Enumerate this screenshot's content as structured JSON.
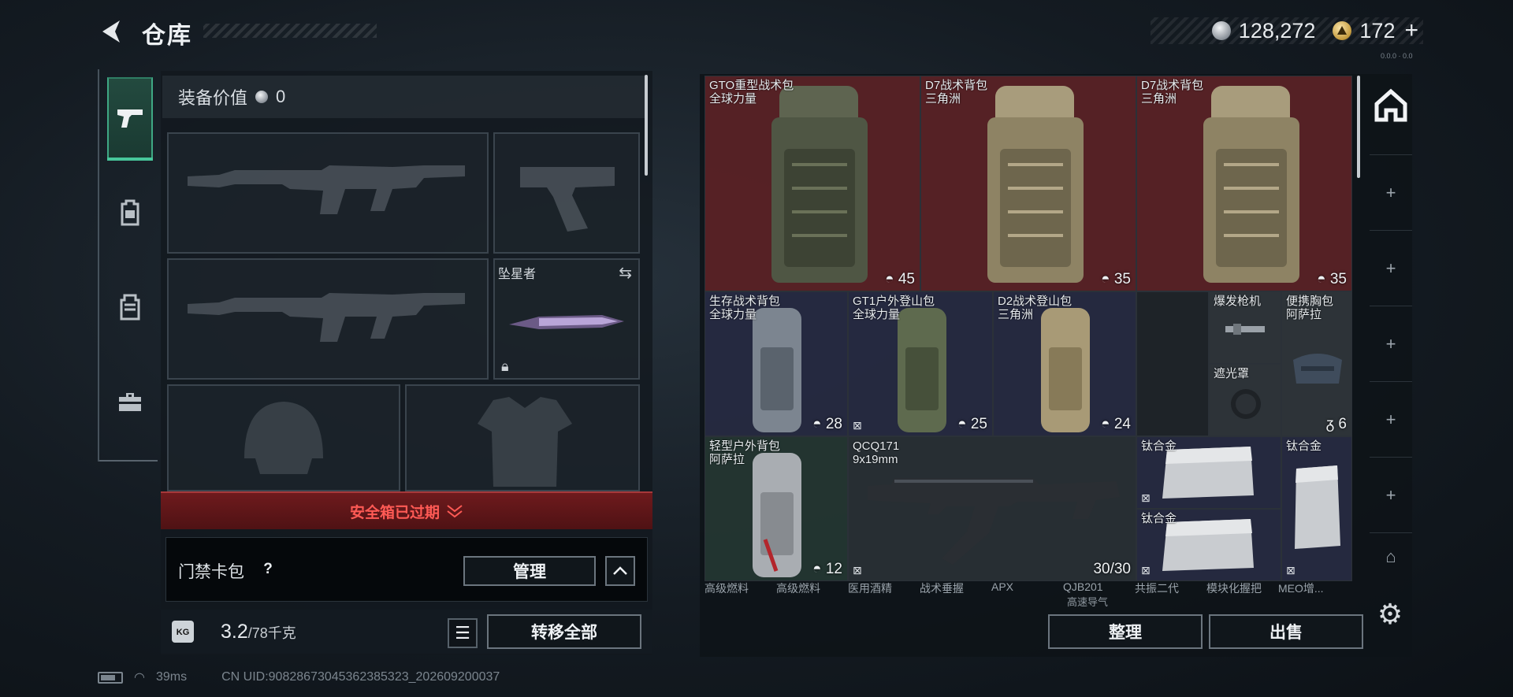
{
  "header": {
    "title": "仓库"
  },
  "currency": {
    "silver": "128,272",
    "gold": "172",
    "plus": "+"
  },
  "left_tabs": [
    {
      "icon": "pistol-icon"
    },
    {
      "icon": "backpack-icon"
    },
    {
      "icon": "vest-icon"
    },
    {
      "icon": "toolbox-icon"
    }
  ],
  "equipment": {
    "value_label": "装备价值",
    "value": "0",
    "melee_label": "坠星者",
    "safe_box_status": "安全箱已过期"
  },
  "card_pack": {
    "label": "门禁卡包",
    "help": "?",
    "manage_label": "管理"
  },
  "weight": {
    "current": "3.2",
    "max": "/78千克",
    "unit_icon": "KG"
  },
  "transfer_all_label": "转移全部",
  "storage": {
    "items": [
      {
        "name": "GTO重型战术包\n全球力量",
        "cap": "45"
      },
      {
        "name": "D7战术背包\n三角洲",
        "cap": "35"
      },
      {
        "name": "D7战术背包\n三角洲",
        "cap": "35"
      },
      {
        "name": "生存战术背包\n全球力量",
        "cap": "28"
      },
      {
        "name": "GT1户外登山包\n全球力量",
        "cap": "25"
      },
      {
        "name": "D2战术登山包\n三角洲",
        "cap": "24"
      },
      {
        "name": "爆发枪机"
      },
      {
        "name": "便携胸包\n阿萨拉",
        "cap": "6"
      },
      {
        "name": "遮光罩"
      },
      {
        "name": "轻型户外背包\n阿萨拉",
        "cap": "12"
      },
      {
        "name": "QCQ171\n9x19mm",
        "ammo": "30/30"
      },
      {
        "name": "钛合金"
      },
      {
        "name": "钛合金"
      },
      {
        "name": "钛合金"
      }
    ],
    "bottom_row": [
      "高级燃料",
      "高级燃料",
      "医用酒精",
      "战术垂握",
      "APX",
      "QJB201",
      "共振二代",
      "模块化握把",
      "MEO增..."
    ],
    "bottom_sub": "高速导气"
  },
  "actions": {
    "organize": "整理",
    "sell": "出售"
  },
  "footer": {
    "ping": "39ms",
    "uid": "CN UID:9082867304536238532​3_202609200037"
  },
  "version_tiny": "0.0.0 · 0.0"
}
